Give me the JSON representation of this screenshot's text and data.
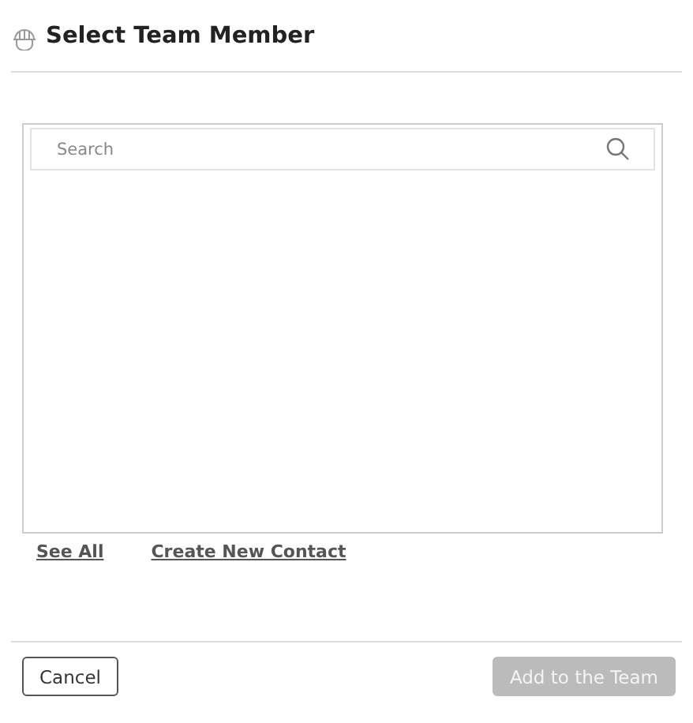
{
  "dialog": {
    "title": "Select Team Member"
  },
  "search": {
    "placeholder": "Search"
  },
  "links": [
    {
      "label": "See All"
    },
    {
      "label": "Create New Contact"
    }
  ],
  "buttons": [
    {
      "label": "Cancel",
      "kind": "secondary",
      "disabled": false
    },
    {
      "label": "Add to the Team",
      "kind": "primary",
      "disabled": true
    }
  ]
}
